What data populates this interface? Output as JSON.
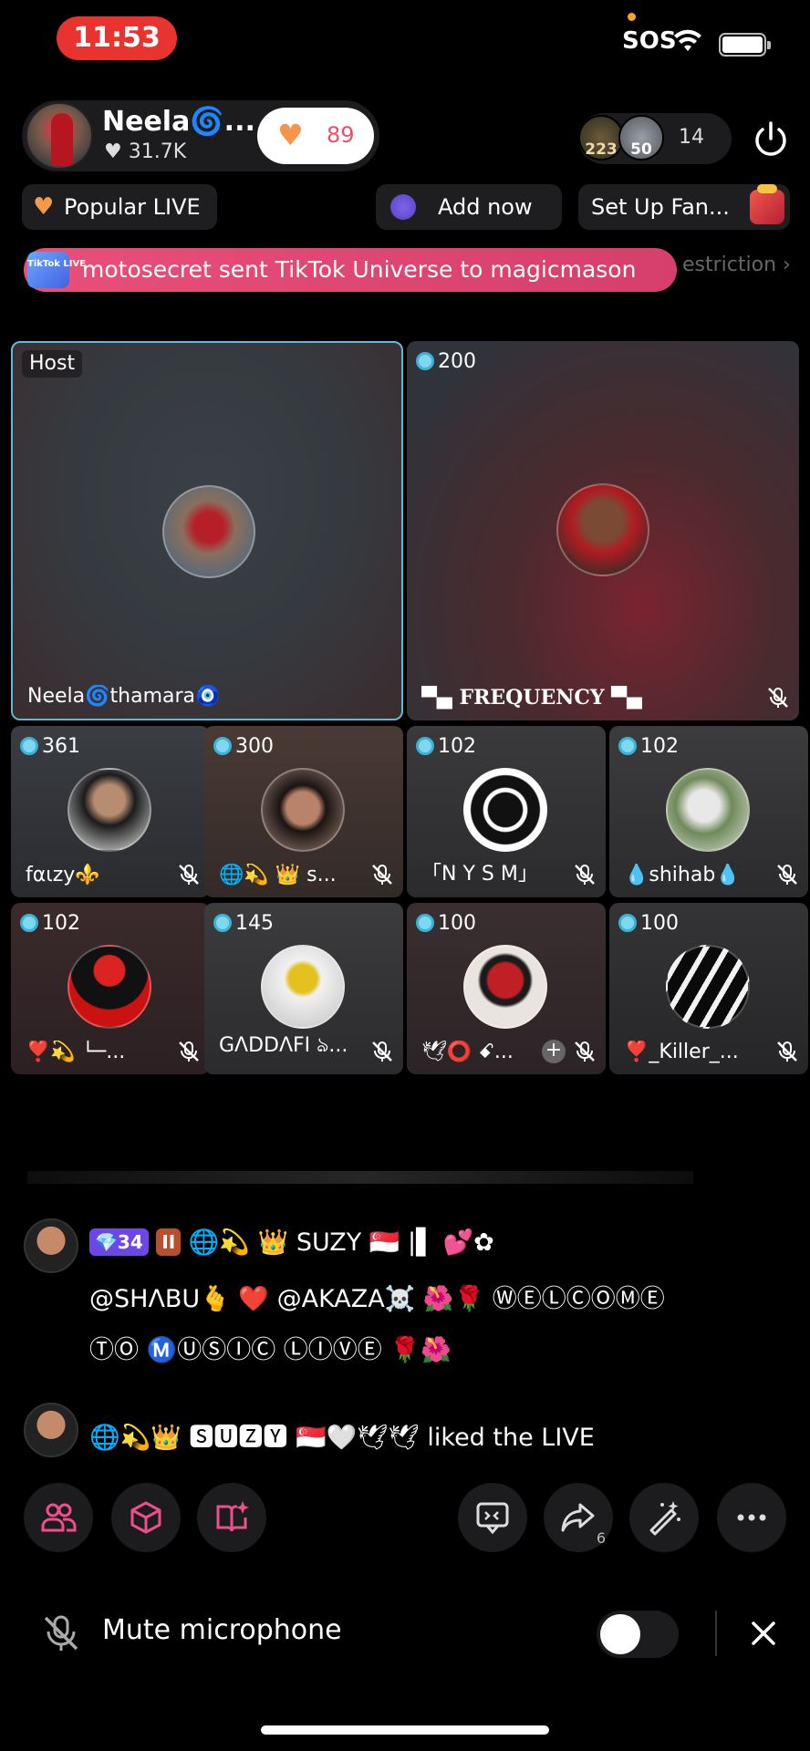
{
  "status_bar": {
    "time": "11:53",
    "sos": "SOS"
  },
  "host": {
    "name": "Neela🌀...",
    "likes": "♥ 31.7K",
    "heart_count": "89"
  },
  "viewers": {
    "avatar1_badge": "223",
    "avatar2_badge": "50",
    "count": "14"
  },
  "chips": {
    "popular": "Popular LIVE",
    "add_now": "Add now",
    "fan_club": "Set Up Fan..."
  },
  "banner": {
    "badge": "TikTok LIVE",
    "text": "motosecret sent TikTok Universe to magicmason",
    "restriction": "estriction ›"
  },
  "tiles": [
    {
      "label": "Host",
      "name": "Neela🌀thamara🧿"
    },
    {
      "score": "200",
      "name": "▀▄ FREQUENCY ▀▄"
    },
    {
      "score": "361",
      "name": "fαιzy⚜️"
    },
    {
      "score": "300",
      "name": "🌐💫 👑 s..."
    },
    {
      "score": "102",
      "name": "「N Y S M」"
    },
    {
      "score": "102",
      "name": "💧shihab💧"
    },
    {
      "score": "102",
      "name": "❣️💫 └─..."
    },
    {
      "score": "145",
      "name": "GΛDDΛFI ঌ..."
    },
    {
      "score": "100",
      "name": "🕊⭕ ꗃ..."
    },
    {
      "score": "100",
      "name": "❣️_Killer_..."
    }
  ],
  "chat": {
    "msg1_level": "💎34",
    "msg1_badge2": "II",
    "msg1_user": "🌐💫 👑 SUZY 🇸🇬 |▌ 💕✿",
    "msg1_line2": "@SHΛBU🫰 ❤️ @AKAZA☠️ 🌺🌹 ⓌⒺⓁⒸⓄⓂⒺ",
    "msg1_line3": "ⓉⓄ Ⓜ️ⓊⓈⒾⒸ ⓁⒾⓋⒺ 🌹🌺",
    "msg2": "🌐💫👑 🆂🆄🆉🆈 🇸🇬🤍🕊🕊 liked the LIVE"
  },
  "toolbar": {
    "share_count": "6"
  },
  "mute": {
    "label": "Mute microphone"
  },
  "colors": {
    "accent_pink": "#e8507a",
    "host_border": "#5fb8d6",
    "score_dot": "#7fd8ef",
    "time_pill": "#e8332f"
  }
}
